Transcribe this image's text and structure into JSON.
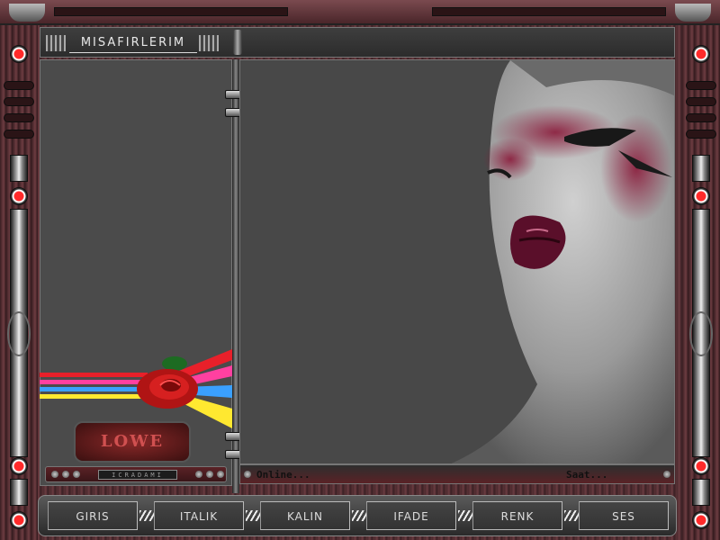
{
  "window": {
    "title": "MISAFIRLERIM"
  },
  "left_panel": {
    "badge_text": "LOWE",
    "strip_screen_text": "ICRADAMI"
  },
  "status": {
    "online_label": "Online...",
    "time_label": "Saat..."
  },
  "nav": {
    "items": [
      {
        "label": "GIRIS"
      },
      {
        "label": "ITALIK"
      },
      {
        "label": "KALIN"
      },
      {
        "label": "IFADE"
      },
      {
        "label": "RENK"
      },
      {
        "label": "SES"
      }
    ]
  },
  "colors": {
    "accent": "#ff2a2a",
    "wood": "#5a3236",
    "panel": "#4b4b4b",
    "rainbow": [
      "#e8202a",
      "#ff40a0",
      "#3aa0ff",
      "#ffe830"
    ]
  },
  "icons": {
    "bulb": "red-bulb-icon",
    "rose": "rose-icon",
    "separator": "hatch-separator-icon"
  }
}
